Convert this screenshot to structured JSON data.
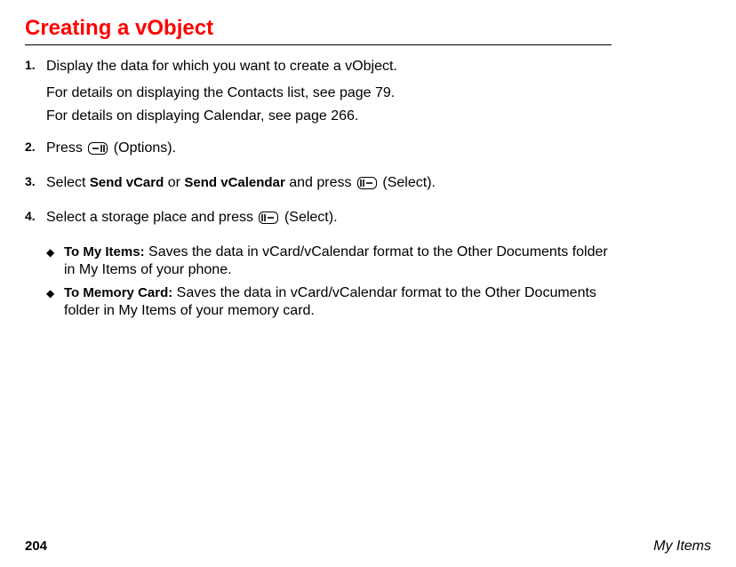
{
  "heading": "Creating a vObject",
  "steps": [
    {
      "num": "1.",
      "lines": [
        "Display the data for which you want to create a vObject."
      ],
      "extra": [
        "For details on displaying the Contacts list, see page 79.",
        "For details on displaying Calendar, see page 266."
      ]
    },
    {
      "num": "2.",
      "segments": [
        {
          "t": "Press "
        },
        {
          "icon": "softkey-right"
        },
        {
          "t": " (Options)."
        }
      ]
    },
    {
      "num": "3.",
      "segments": [
        {
          "t": "Select "
        },
        {
          "t": "Send vCard",
          "bold": true
        },
        {
          "t": " or "
        },
        {
          "t": "Send vCalendar",
          "bold": true
        },
        {
          "t": " and press "
        },
        {
          "icon": "softkey-left"
        },
        {
          "t": " (Select)."
        }
      ]
    },
    {
      "num": "4.",
      "segments": [
        {
          "t": "Select a storage place and press "
        },
        {
          "icon": "softkey-left"
        },
        {
          "t": " (Select)."
        }
      ]
    }
  ],
  "sublist": [
    {
      "label": "To My Items:",
      "text": " Saves the data in vCard/vCalendar format to the Other Documents folder in My Items of your phone."
    },
    {
      "label": "To Memory Card:",
      "text": " Saves the data in vCard/vCalendar format to the Other Documents folder in My Items of your memory card."
    }
  ],
  "footer": {
    "page": "204",
    "section": "My Items"
  }
}
